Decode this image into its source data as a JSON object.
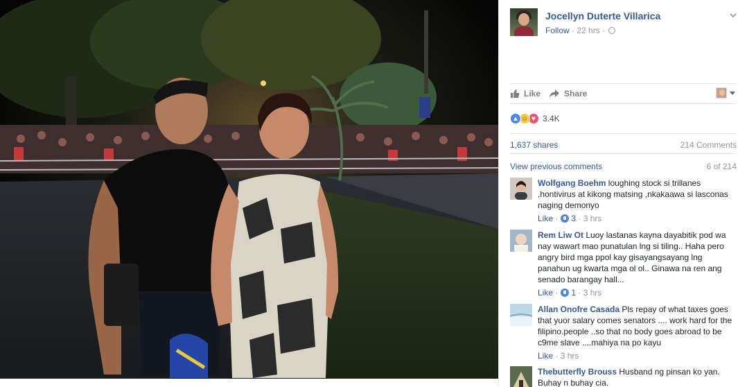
{
  "post": {
    "author": "Jocellyn Duterte Villarica",
    "follow_label": "Follow",
    "time": "22 hrs"
  },
  "actions": {
    "like_label": "Like",
    "share_label": "Share"
  },
  "reactions": {
    "count": "3.4K",
    "icons": [
      "like-icon",
      "haha-icon",
      "love-icon"
    ]
  },
  "stats": {
    "shares": "1,637 shares",
    "comments": "214 Comments"
  },
  "comments_section": {
    "view_previous": "View previous comments",
    "page_count": "6 of 214",
    "items": [
      {
        "name": "Wolfgang Boehm",
        "text": "loughing stock si trillanes ,hontivirus at kikong matsing ,nkakaawa si lasconas naging demonyo",
        "like_label": "Like",
        "reactions": "3",
        "time": "3 hrs"
      },
      {
        "name": "Rem Liw Ot",
        "text": "Luoy lastanas kayna dayabitik pod wa nay wawart mao punatulan lng si tiling.. Haha pero angry bird mga ppol kay gisayangsayang lng panahun ug kwarta mga ol ol.. Ginawa na ren ang senado barangay hall...",
        "like_label": "Like",
        "reactions": "1",
        "time": "3 hrs"
      },
      {
        "name": "Allan Onofre Casada",
        "text": "Pls repay of what taxes goes that yuor salary comes senators .... work hard for the filipino.people ..so that no body goes abroad to be c9me slave ....mahiya na po kayu",
        "like_label": "Like",
        "reactions": "",
        "time": "3 hrs"
      },
      {
        "name": "Thebutterfly Brouss",
        "text": "Husband ng pinsan ko yan. Buhay n buhay cia.",
        "like_label": "",
        "reactions": "",
        "time": ""
      }
    ]
  },
  "colors": {
    "link_blue": "#365899",
    "meta_gray": "#90949c",
    "like_blue": "#4e86e4",
    "love_red": "#f0546f",
    "haha_yellow": "#f7c744"
  }
}
